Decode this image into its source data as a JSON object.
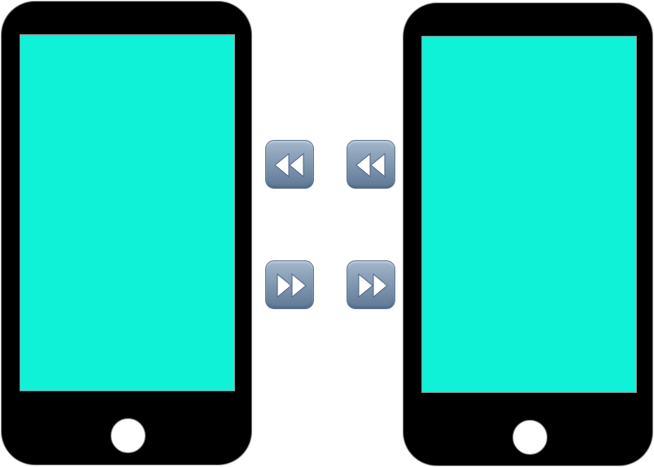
{
  "colors": {
    "phone_body": "#000000",
    "phone_outline": "#8a8a8a",
    "screen": "#0ff2d8",
    "home_button": "#ffffff",
    "button_top": "#a3b6cb",
    "button_bottom": "#5e7896",
    "arrow": "#ffffff"
  },
  "phones": [
    {
      "name": "left-phone",
      "screen_color": "#0ff2d8"
    },
    {
      "name": "right-phone",
      "screen_color": "#0ff2d8"
    }
  ],
  "controls": [
    {
      "name": "rewind-button-left",
      "icon": "rewind-icon"
    },
    {
      "name": "rewind-button-right",
      "icon": "rewind-icon"
    },
    {
      "name": "fast-forward-button-left",
      "icon": "fast-forward-icon"
    },
    {
      "name": "fast-forward-button-right",
      "icon": "fast-forward-icon"
    }
  ]
}
